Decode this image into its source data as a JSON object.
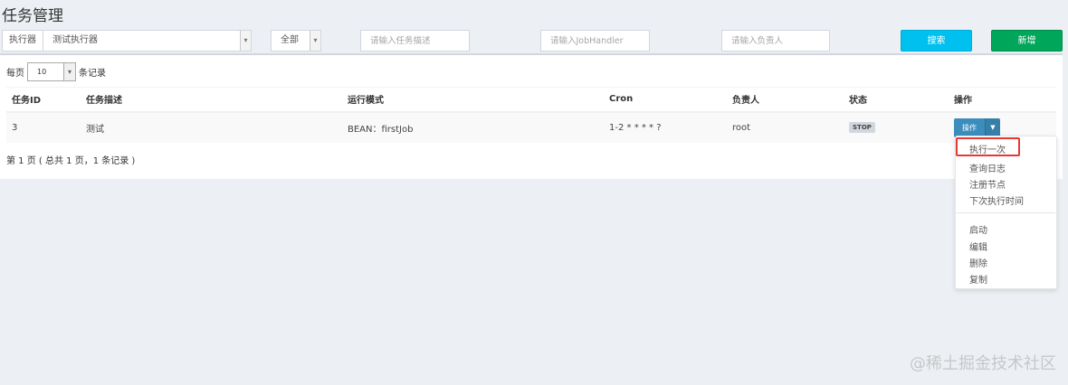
{
  "page": {
    "title": "任务管理"
  },
  "filters": {
    "executor_label": "执行器",
    "executor_value": "测试执行器",
    "status_value": "全部",
    "desc_placeholder": "请输入任务描述",
    "handler_placeholder": "请输入JobHandler",
    "owner_placeholder": "请输入负责人",
    "search_label": "搜索",
    "add_label": "新增"
  },
  "length": {
    "prefix": "每页",
    "value": "10",
    "suffix": "条记录"
  },
  "table": {
    "headers": [
      "任务ID",
      "任务描述",
      "运行模式",
      "Cron",
      "负责人",
      "状态",
      "操作"
    ],
    "rows": [
      {
        "id": "3",
        "desc": "测试",
        "mode": "BEAN：firstJob",
        "cron": "1-2 * * * * ?",
        "owner": "root",
        "status": "STOP",
        "op": "操作"
      }
    ]
  },
  "pagination_info": "第 1 页 ( 总共 1 页，1 条记录 )",
  "dropdown": {
    "group1": [
      "执行一次",
      "查询日志",
      "注册节点",
      "下次执行时间"
    ],
    "group2": [
      "启动",
      "编辑",
      "删除",
      "复制"
    ]
  },
  "watermark": "@稀土掘金技术社区",
  "colors": {
    "search": "#00c0ef",
    "add": "#00a65a",
    "op": "#3c8dbc",
    "highlight": "#e53935"
  }
}
